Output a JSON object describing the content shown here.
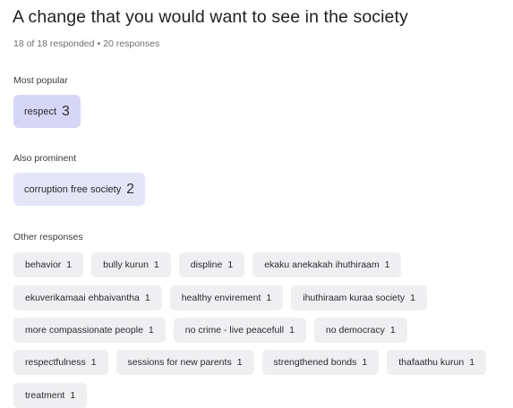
{
  "question": {
    "title": "A change that you would want to see in the society",
    "responded": "18 of 18 responded",
    "separator": "•",
    "responses": "20 responses"
  },
  "most_popular": {
    "label": "Most popular",
    "items": [
      {
        "text": "respect",
        "count": "3"
      }
    ]
  },
  "also_prominent": {
    "label": "Also prominent",
    "items": [
      {
        "text": "corruption free society",
        "count": "2"
      }
    ]
  },
  "other_responses": {
    "label": "Other responses",
    "rows": [
      [
        {
          "text": "behavior",
          "count": "1"
        },
        {
          "text": "bully kurun",
          "count": "1"
        },
        {
          "text": "displine",
          "count": "1"
        },
        {
          "text": "ekaku anekakah ihuthiraam",
          "count": "1"
        }
      ],
      [
        {
          "text": "ekuverikamaai ehbaivantha",
          "count": "1"
        },
        {
          "text": "healthy envirement",
          "count": "1"
        },
        {
          "text": "ihuthiraam kuraa society",
          "count": "1"
        }
      ],
      [
        {
          "text": "more compassionate people",
          "count": "1"
        },
        {
          "text": "no crime - live peacefull",
          "count": "1"
        },
        {
          "text": "no democracy",
          "count": "1"
        }
      ],
      [
        {
          "text": "respectfulness",
          "count": "1"
        },
        {
          "text": "sessions for new parents",
          "count": "1"
        },
        {
          "text": "strengthened bonds",
          "count": "1"
        },
        {
          "text": "thafaathu kurun",
          "count": "1"
        }
      ],
      [
        {
          "text": "treatment",
          "count": "1"
        }
      ]
    ]
  },
  "colors": {
    "popular_chip": "#d6d6f6",
    "prominent_chip": "#e4e6f8",
    "response_chip": "#efeff1"
  }
}
